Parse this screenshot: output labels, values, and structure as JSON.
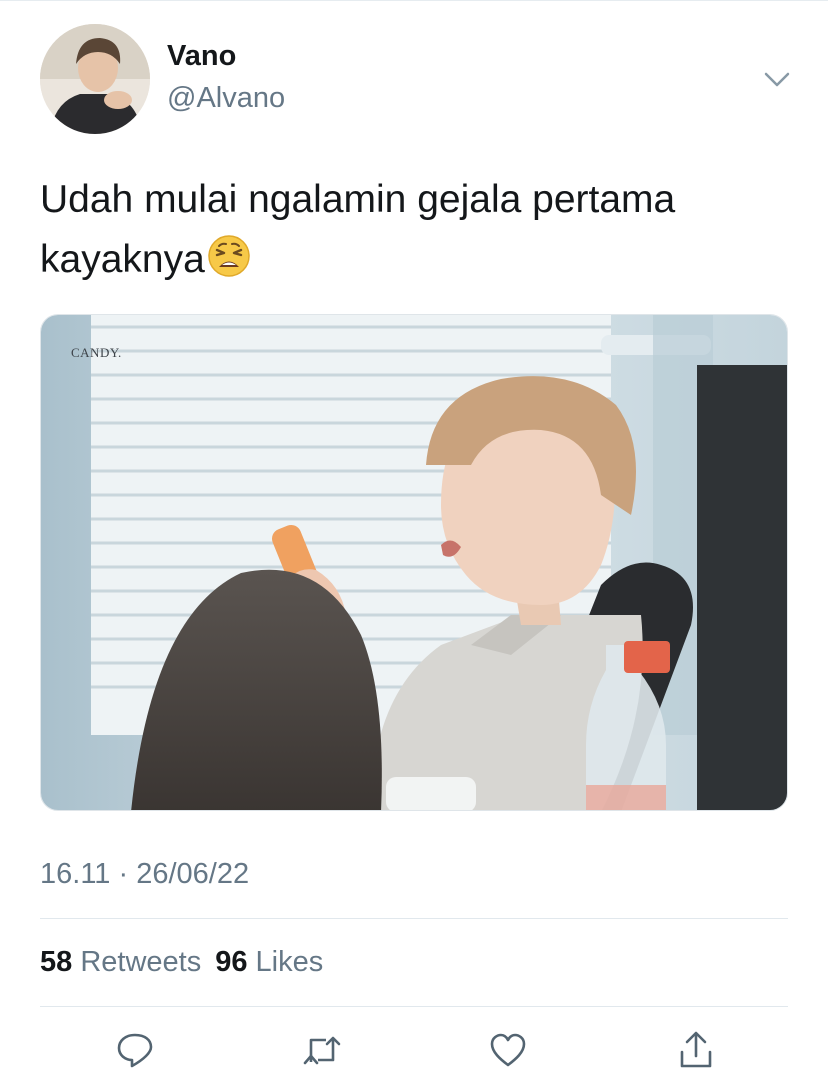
{
  "user": {
    "name": "Vano",
    "handle": "@Alvano"
  },
  "tweet": {
    "text": "Udah mulai ngalamin gejala pertama kayaknya",
    "emoji": "weary-face-emoji"
  },
  "media": {
    "watermark": "CANDY."
  },
  "meta": {
    "timestamp": "16.11 · 26/06/22"
  },
  "stats": {
    "retweets_count": "58",
    "retweets_label": "Retweets",
    "likes_count": "96",
    "likes_label": "Likes"
  },
  "actions": [
    {
      "name": "reply",
      "icon": "speech-bubble-icon"
    },
    {
      "name": "retweet",
      "icon": "retweet-arrows-icon"
    },
    {
      "name": "like",
      "icon": "heart-icon"
    },
    {
      "name": "share",
      "icon": "share-upload-icon"
    }
  ],
  "colors": {
    "text_primary": "#14171a",
    "text_secondary": "#657786",
    "divider": "#e1e8ed"
  }
}
